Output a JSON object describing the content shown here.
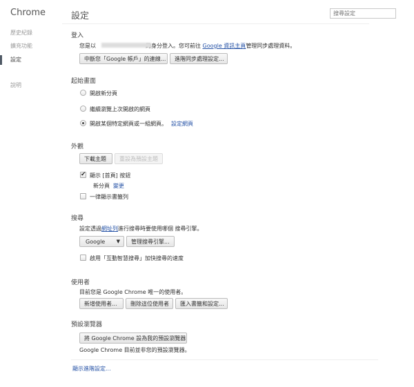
{
  "sidebar": {
    "brand": "Chrome",
    "items": [
      {
        "label": "歷史紀錄"
      },
      {
        "label": "擴充功能"
      },
      {
        "label": "設定"
      },
      {
        "label": "說明"
      }
    ]
  },
  "header": {
    "title": "設定",
    "search_placeholder": "搜尋設定"
  },
  "signin": {
    "heading": "登入",
    "text_prefix": "您是以",
    "text_middle": "的身分登入。您可前往 ",
    "link": "Google 資訊主頁",
    "text_suffix": "管理同步處理資料。",
    "disconnect_button": "中斷您「Google 帳戶」的連線...",
    "advanced_sync_button": "進階同步處理設定..."
  },
  "startup": {
    "heading": "起始畫面",
    "options": [
      {
        "label": "開啟新分頁"
      },
      {
        "label": "繼續瀏覽上次開啟的網頁"
      },
      {
        "label": "開啟某個特定網頁或一組網頁。"
      }
    ],
    "set_pages_link": "設定網頁",
    "selected_index": 2
  },
  "appearance": {
    "heading": "外觀",
    "get_themes_button": "下載主題",
    "reset_theme_button": "重設為預設主題",
    "show_home_label": "顯示 [首頁] 按鈕",
    "show_home_checked": true,
    "home_value": "新分頁",
    "change_link": "變更",
    "bookmarks_bar_label": "一律顯示書籤列",
    "bookmarks_bar_checked": false
  },
  "search": {
    "heading": "搜尋",
    "text_prefix": "設定透過",
    "link": "網址列",
    "text_suffix": "進行搜尋時要使用哪個 搜尋引擎。",
    "engine": "Google",
    "manage_button": "管理搜尋引擎...",
    "instant_label": "啟用「互動智慧搜尋」加快搜尋的速度",
    "instant_checked": false
  },
  "users": {
    "heading": "使用者",
    "text": "目前您是 Google Chrome 唯一的使用者。",
    "add_button": "新增使用者...",
    "delete_button": "刪除這位使用者",
    "import_button": "匯入書籤和設定..."
  },
  "default_browser": {
    "heading": "預設瀏覽器",
    "button": "將 Google Chrome 設為我的預設瀏覽器",
    "status": "Google Chrome 目前並非您的預設瀏覽器。"
  },
  "advanced_link": "顯示進階設定..."
}
